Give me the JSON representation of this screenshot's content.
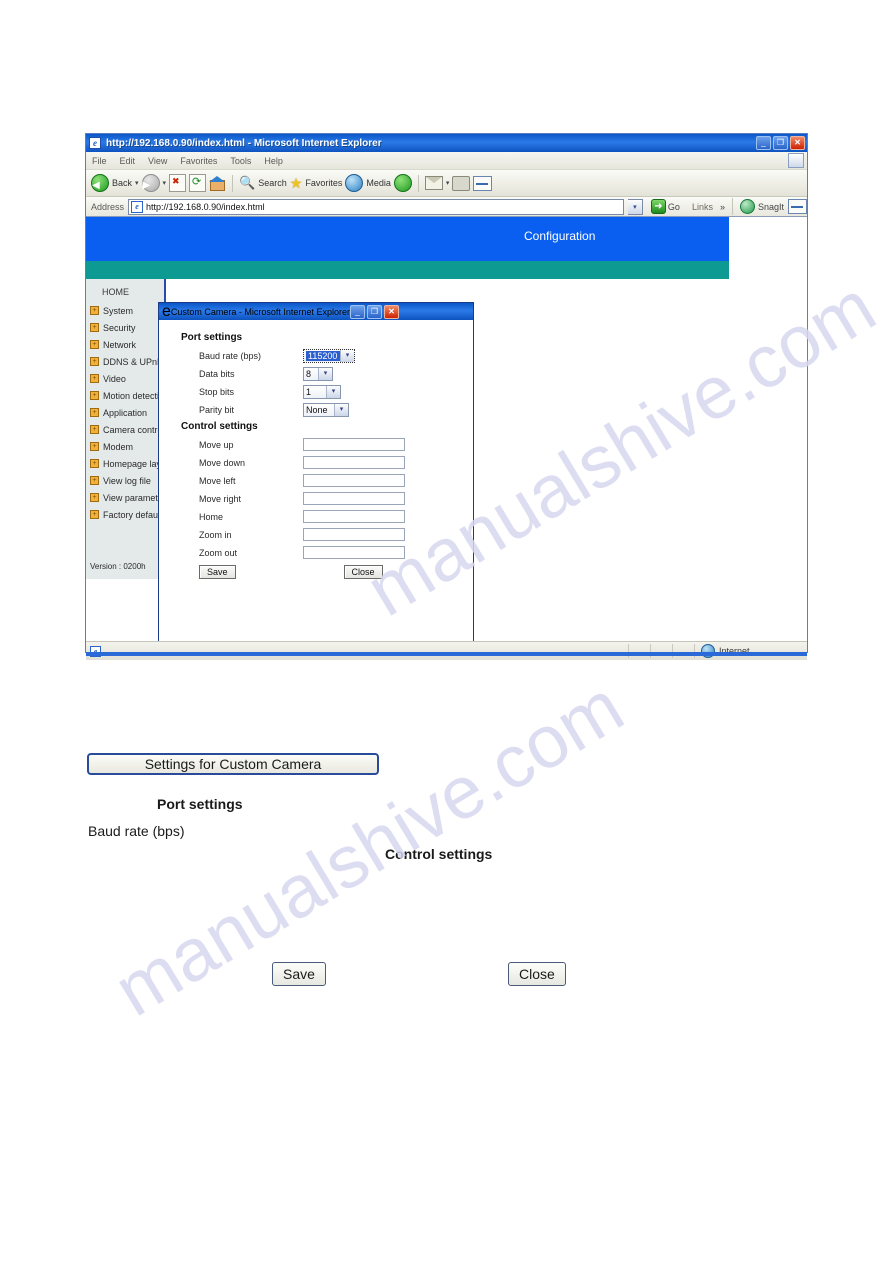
{
  "browser": {
    "title": "http://192.168.0.90/index.html - Microsoft Internet Explorer",
    "ie_glyph": "e",
    "window_buttons": {
      "minimize": "_",
      "restore": "❐",
      "close": "✕"
    },
    "menu": [
      "File",
      "Edit",
      "View",
      "Favorites",
      "Tools",
      "Help"
    ],
    "toolbar": {
      "back_label": "Back",
      "back_caret": "▾",
      "forward_caret": "▾",
      "stop_label": "Stop",
      "refresh_label": "Refresh",
      "home_label": "Home",
      "search_label": "Search",
      "favorites_label": "Favorites",
      "media_label": "Media",
      "history_label": "History",
      "mail_label": "Mail",
      "print_label": "Print",
      "edit_label": "Edit"
    },
    "address": {
      "label": "Address",
      "value": "http://192.168.0.90/index.html",
      "dropdown_arrow": "▾",
      "go_label": "Go",
      "go_arrow": "➜",
      "links_label": "Links",
      "links_chevron": "»",
      "snagit_label": "SnagIt"
    },
    "statusbar": {
      "zone_label": "Internet"
    }
  },
  "page": {
    "banner_title": "Configuration",
    "banner_blue": "#0a5ff0",
    "banner_teal": "#0c9a92",
    "sidebar": {
      "home_label": "HOME",
      "expand_glyph": "+",
      "items": [
        {
          "label": "System"
        },
        {
          "label": "Security"
        },
        {
          "label": "Network"
        },
        {
          "label": "DDNS & UPnP"
        },
        {
          "label": "Video"
        },
        {
          "label": "Motion detection"
        },
        {
          "label": "Application"
        },
        {
          "label": "Camera control"
        },
        {
          "label": "Modem"
        },
        {
          "label": "Homepage layout"
        },
        {
          "label": "View log file"
        },
        {
          "label": "View parameters"
        },
        {
          "label": "Factory default"
        }
      ],
      "version": "Version : 0200h"
    }
  },
  "dialog": {
    "title": "Custom Camera - Microsoft Internet Explorer",
    "ie_glyph": "e",
    "window_buttons": {
      "minimize": "_",
      "restore": "❐",
      "close": "✕"
    },
    "port_settings": {
      "heading": "Port settings",
      "fields": [
        {
          "label": "Baud rate (bps)",
          "value": "115200",
          "arrow": "▾",
          "focused": true
        },
        {
          "label": "Data bits",
          "value": "8",
          "arrow": "▾",
          "focused": false
        },
        {
          "label": "Stop bits",
          "value": "1",
          "arrow": "▾",
          "focused": false
        },
        {
          "label": "Parity bit",
          "value": "None",
          "arrow": "▾",
          "focused": false
        }
      ]
    },
    "control_settings": {
      "heading": "Control settings",
      "fields": [
        {
          "label": "Move up",
          "value": ""
        },
        {
          "label": "Move down",
          "value": ""
        },
        {
          "label": "Move left",
          "value": ""
        },
        {
          "label": "Move right",
          "value": ""
        },
        {
          "label": "Home",
          "value": ""
        },
        {
          "label": "Zoom in",
          "value": ""
        },
        {
          "label": "Zoom out",
          "value": ""
        }
      ]
    },
    "save_label": "Save",
    "close_label": "Close"
  },
  "annotation": {
    "header_button": "Settings for Custom Camera",
    "port_settings_heading": "Port settings",
    "baud_rate_label": "Baud rate (bps)",
    "control_settings_heading": "Control settings",
    "save_label": "Save",
    "close_label": "Close"
  },
  "watermark": {
    "text_a": "manualshive.com",
    "text_b": "manualshive.com"
  }
}
